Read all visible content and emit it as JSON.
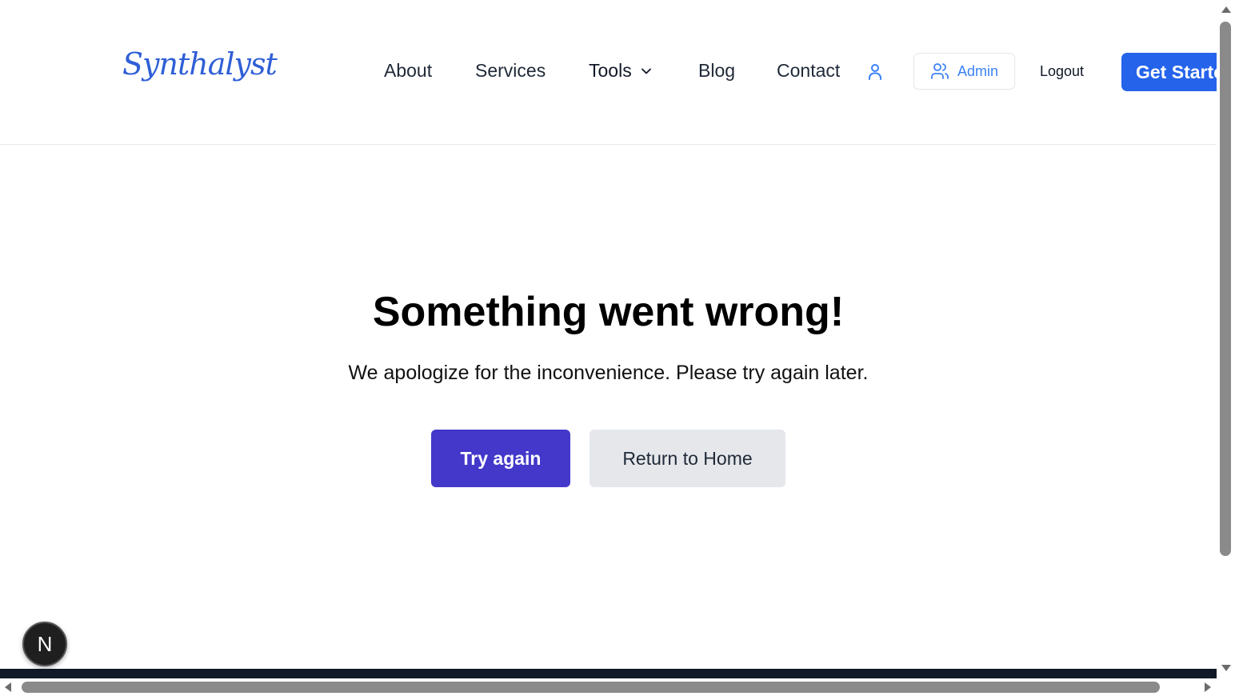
{
  "brand": {
    "logo_text": "Synthalyst",
    "logo_color": "#2f5fd6"
  },
  "nav": {
    "about": "About",
    "services": "Services",
    "tools": "Tools",
    "blog": "Blog",
    "contact": "Contact"
  },
  "actions": {
    "admin_label": "Admin",
    "logout_label": "Logout",
    "get_started_label": "Get Started"
  },
  "error": {
    "title": "Something went wrong!",
    "message": "We apologize for the inconvenience. Please try again later.",
    "try_again_label": "Try again",
    "return_home_label": "Return to Home"
  },
  "badge": {
    "letter": "N"
  },
  "colors": {
    "primary": "#2563eb",
    "try_again_bg": "#4338ca",
    "return_home_bg": "#e5e7eb",
    "admin_text": "#3b82f6"
  },
  "icons": {
    "tools_dropdown": "chevron-down-icon",
    "user": "user-icon",
    "admin": "users-icon"
  }
}
